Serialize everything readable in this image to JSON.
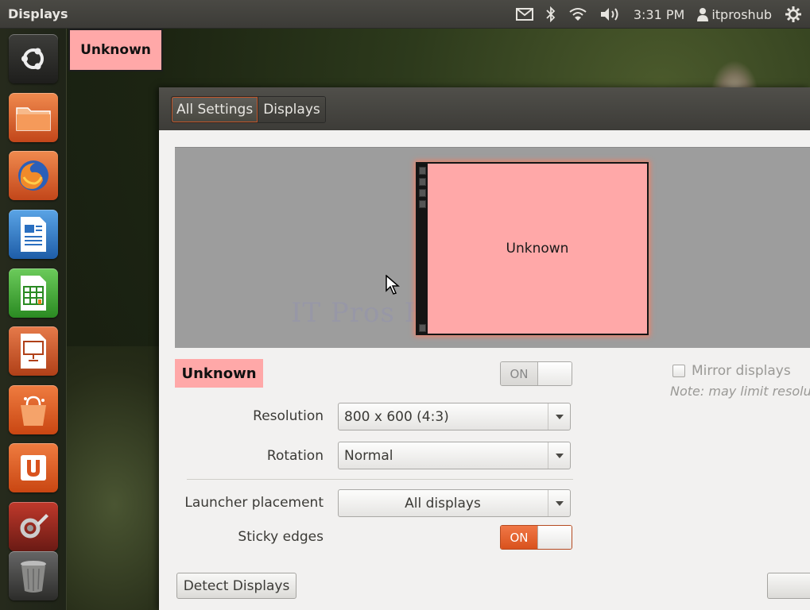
{
  "top_panel": {
    "app_title": "Displays",
    "time": "3:31 PM",
    "user": "itproshub",
    "icons": [
      "mail-icon",
      "bluetooth-icon",
      "wifi-icon",
      "volume-icon",
      "user-icon",
      "gear-icon"
    ]
  },
  "launcher": {
    "items": [
      {
        "name": "ubuntu-home-icon"
      },
      {
        "name": "files-icon"
      },
      {
        "name": "firefox-icon"
      },
      {
        "name": "writer-icon"
      },
      {
        "name": "calc-icon"
      },
      {
        "name": "impress-icon"
      },
      {
        "name": "software-center-icon"
      },
      {
        "name": "ubuntu-one-icon"
      },
      {
        "name": "system-settings-icon"
      },
      {
        "name": "trash-icon"
      }
    ]
  },
  "overlay_label": "Unknown",
  "window": {
    "breadcrumbs": [
      "All Settings",
      "Displays"
    ],
    "preview": {
      "monitor_label": "Unknown",
      "watermark": "IT Pros HUB"
    },
    "display_name": "Unknown",
    "display_switch": {
      "label": "ON",
      "state": "off"
    },
    "mirror": {
      "label": "Mirror displays",
      "checked": false
    },
    "note": "Note: may limit resolu",
    "resolution": {
      "label": "Resolution",
      "value": "800 x 600 (4:3)"
    },
    "rotation": {
      "label": "Rotation",
      "value": "Normal"
    },
    "launcher_placement": {
      "label": "Launcher placement",
      "value": "All displays"
    },
    "sticky_edges": {
      "label": "Sticky edges",
      "switch_label": "ON",
      "state": "on"
    },
    "detect_button": "Detect Displays"
  },
  "colors": {
    "accent": "#dd5b24",
    "monitor_fill": "#ffa8a8",
    "panel": "#3c3b37"
  }
}
